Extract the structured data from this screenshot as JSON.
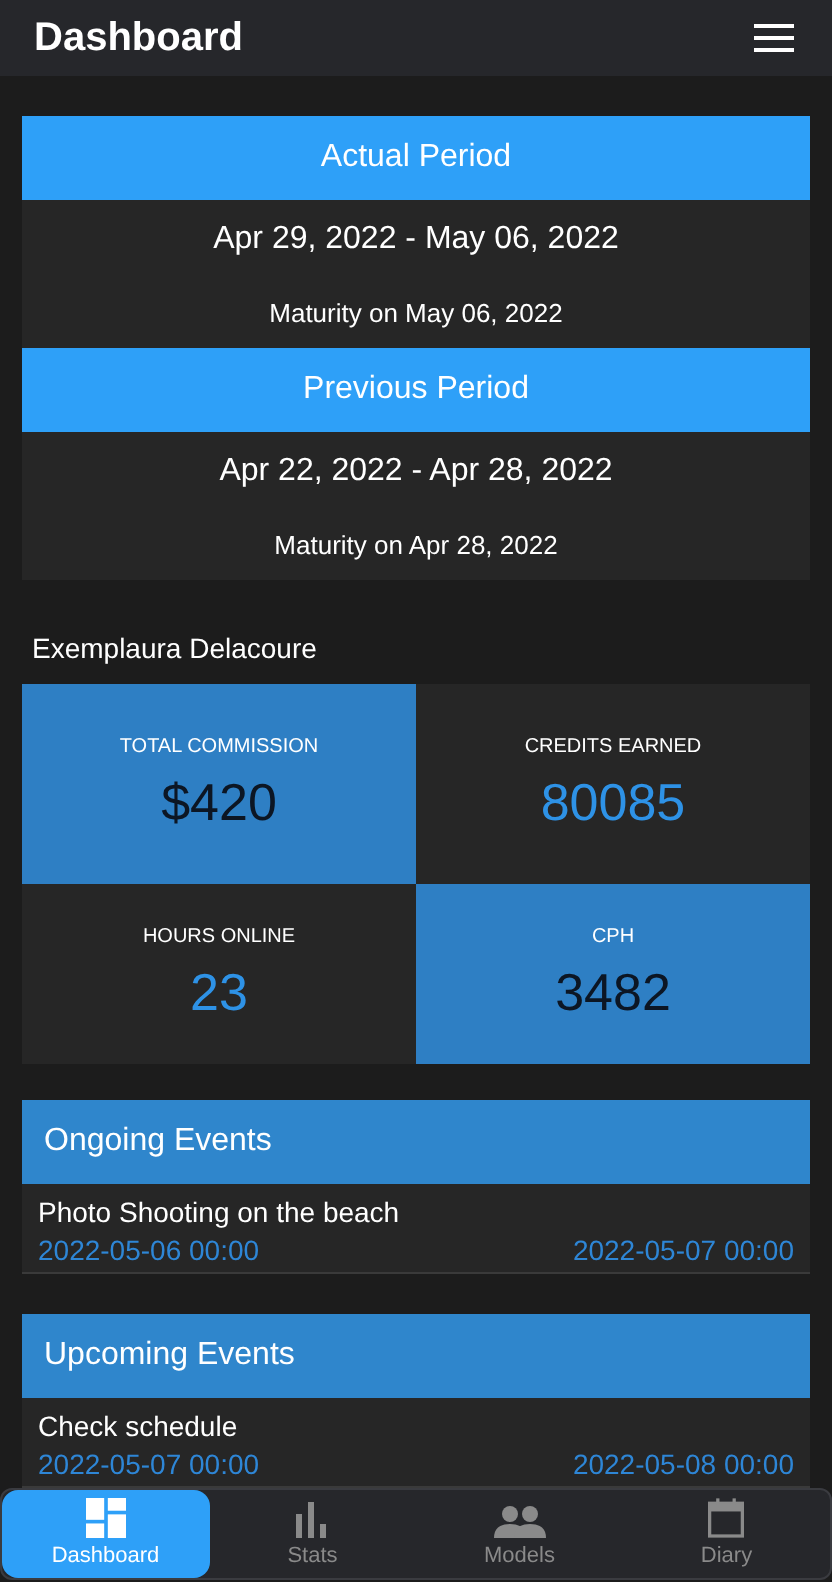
{
  "app_bar": {
    "title": "Dashboard"
  },
  "periods": [
    {
      "title": "Actual Period",
      "range": "Apr 29, 2022 - May 06, 2022",
      "maturity": "Maturity on May 06, 2022"
    },
    {
      "title": "Previous Period",
      "range": "Apr 22, 2022 - Apr 28, 2022",
      "maturity": "Maturity on Apr 28, 2022"
    }
  ],
  "model_name": "Exemplaura Delacoure",
  "stats": [
    {
      "label": "TOTAL COMMISSION",
      "value": "$420",
      "highlighted": true
    },
    {
      "label": "CREDITS EARNED",
      "value": "80085",
      "highlighted": false
    },
    {
      "label": "HOURS ONLINE",
      "value": "23",
      "highlighted": false
    },
    {
      "label": "CPH",
      "value": "3482",
      "highlighted": true
    }
  ],
  "event_sections": [
    {
      "title": "Ongoing Events",
      "events": [
        {
          "name": "Photo Shooting on the beach",
          "start": "2022-05-06 00:00",
          "end": "2022-05-07 00:00"
        }
      ]
    },
    {
      "title": "Upcoming Events",
      "events": [
        {
          "name": "Check schedule",
          "start": "2022-05-07 00:00",
          "end": "2022-05-08 00:00"
        }
      ]
    }
  ],
  "bottom_nav": [
    {
      "label": "Dashboard",
      "kind": "dashboard",
      "selected": true
    },
    {
      "label": "Stats",
      "kind": "stats",
      "selected": false
    },
    {
      "label": "Models",
      "kind": "models",
      "selected": false
    },
    {
      "label": "Diary",
      "kind": "diary",
      "selected": false
    }
  ]
}
